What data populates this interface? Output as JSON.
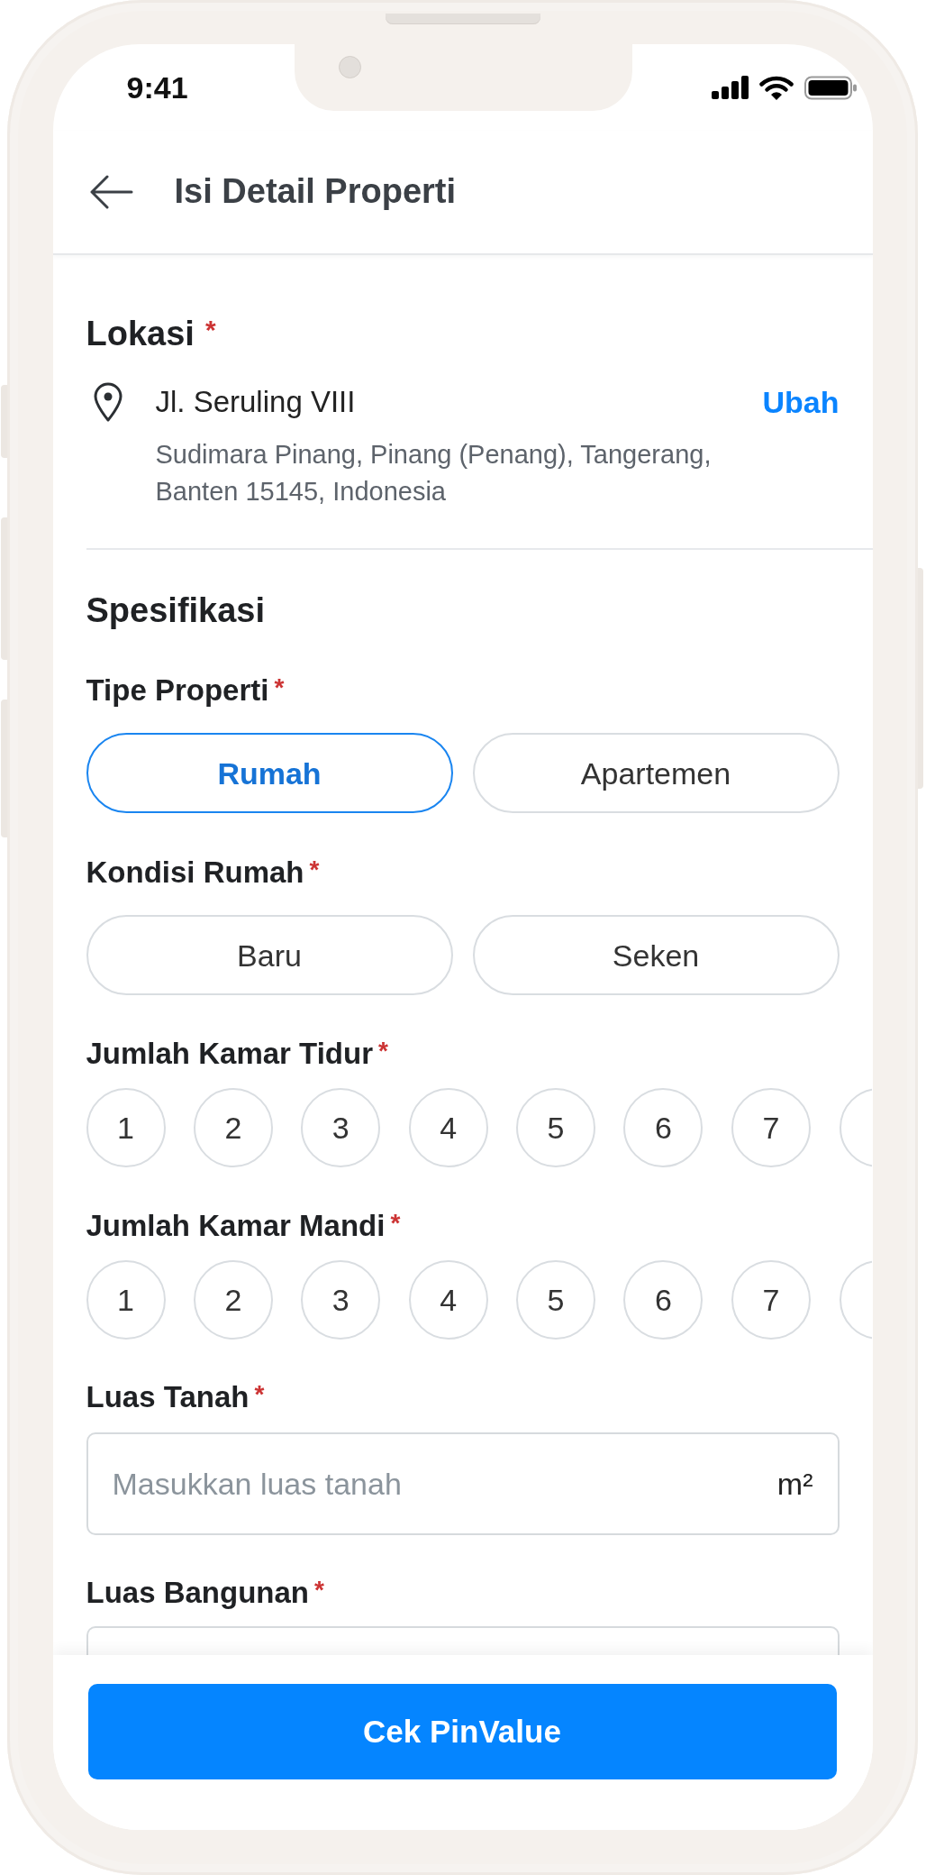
{
  "status_bar": {
    "time": "9:41"
  },
  "header": {
    "title": "Isi Detail Properti"
  },
  "location": {
    "title": "Lokasi",
    "required_mark": "*",
    "street": "Jl. Seruling VIII",
    "address": "Sudimara Pinang, Pinang (Penang), Tangerang, Banten 15145, Indonesia",
    "action": "Ubah"
  },
  "specification": {
    "title": "Spesifikasi",
    "fields": [
      {
        "kind": "pills",
        "label": "Tipe Properti",
        "required_mark": "*",
        "options": [
          {
            "label": "Rumah",
            "selected": true
          },
          {
            "label": "Apartemen",
            "selected": false
          }
        ]
      },
      {
        "kind": "pills",
        "label": "Kondisi Rumah",
        "required_mark": "*",
        "options": [
          {
            "label": "Baru",
            "selected": false
          },
          {
            "label": "Seken",
            "selected": false
          }
        ]
      },
      {
        "kind": "circles",
        "label": "Jumlah Kamar Tidur",
        "required_mark": "*",
        "options": [
          {
            "label": "1",
            "selected": false
          },
          {
            "label": "2",
            "selected": false
          },
          {
            "label": "3",
            "selected": false
          },
          {
            "label": "4",
            "selected": false
          },
          {
            "label": "5",
            "selected": false
          },
          {
            "label": "6",
            "selected": false
          },
          {
            "label": "7",
            "selected": false
          },
          {
            "selected": false
          }
        ]
      },
      {
        "kind": "circles",
        "label": "Jumlah Kamar Mandi",
        "required_mark": "*",
        "options": [
          {
            "label": "1",
            "selected": false
          },
          {
            "label": "2",
            "selected": false
          },
          {
            "label": "3",
            "selected": false
          },
          {
            "label": "4",
            "selected": false
          },
          {
            "label": "5",
            "selected": false
          },
          {
            "label": "6",
            "selected": false
          },
          {
            "label": "7",
            "selected": false
          },
          {
            "selected": false
          }
        ]
      },
      {
        "kind": "input",
        "label": "Luas Tanah",
        "required_mark": "*",
        "placeholder": "Masukkan luas tanah",
        "unit": "m²"
      },
      {
        "kind": "input",
        "label": "Luas Bangunan",
        "required_mark": "*"
      }
    ]
  },
  "footer": {
    "button": "Cek PinValue"
  }
}
